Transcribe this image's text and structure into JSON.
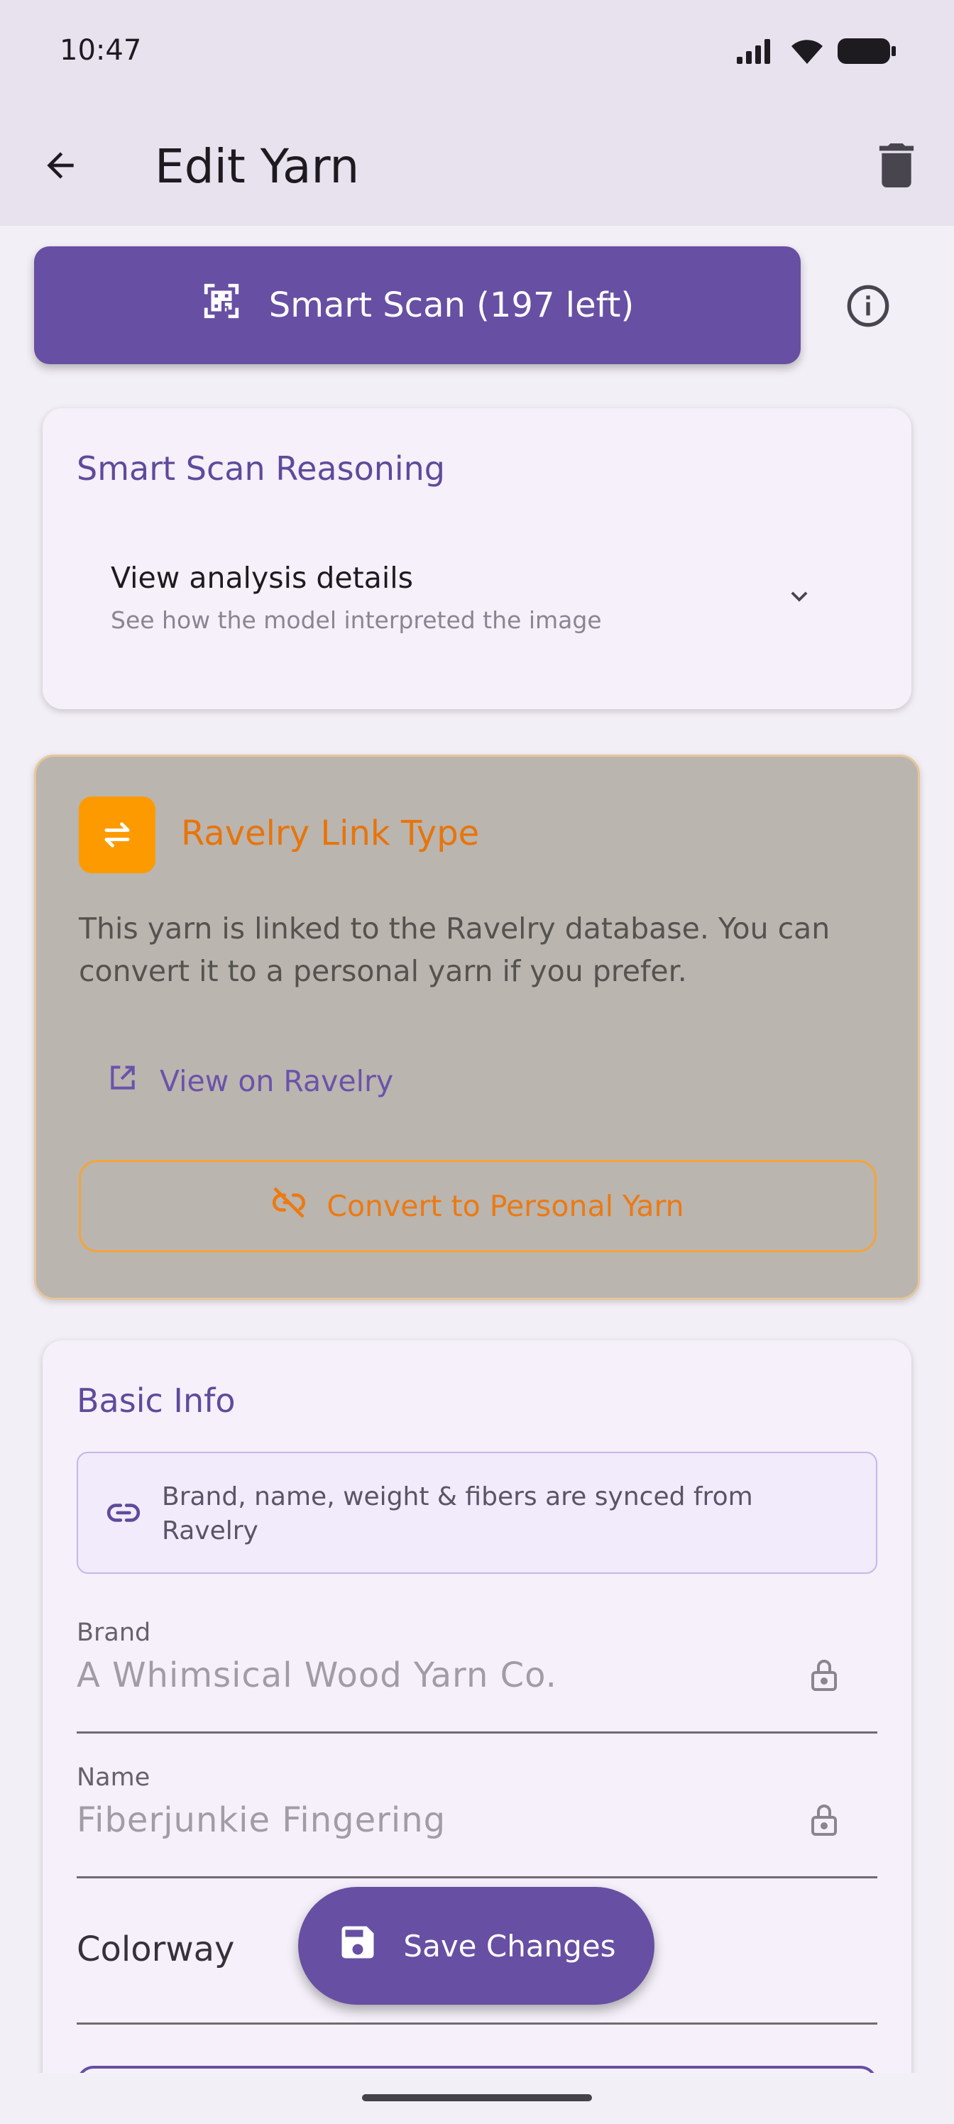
{
  "status_bar": {
    "time": "10:47"
  },
  "app_bar": {
    "title": "Edit Yarn"
  },
  "smart_scan": {
    "label": "Smart Scan (197 left)"
  },
  "reasoning_card": {
    "title": "Smart Scan Reasoning",
    "row_title": "View analysis details",
    "row_subtitle": "See how the model interpreted the image"
  },
  "ravelry_card": {
    "title": "Ravelry Link Type",
    "description": "This yarn is linked to the Ravelry database. You can convert it to a personal yarn if you prefer.",
    "view_link": "View on Ravelry",
    "convert_button": "Convert to Personal Yarn",
    "accent_color": "#fd9a00"
  },
  "basic_info": {
    "title": "Basic Info",
    "sync_note": "Brand, name, weight & fibers are synced from Ravelry",
    "fields": {
      "brand": {
        "label": "Brand",
        "value": "A Whimsical Wood Yarn Co."
      },
      "name": {
        "label": "Name",
        "value": "Fiberjunkie Fingering"
      },
      "colorway": {
        "label": "Colorway",
        "value": ""
      }
    }
  },
  "fab": {
    "label": "Save Changes"
  },
  "colors": {
    "primary": "#674fa3",
    "background": "#f3eff6",
    "appbar": "#e8e1ee"
  }
}
